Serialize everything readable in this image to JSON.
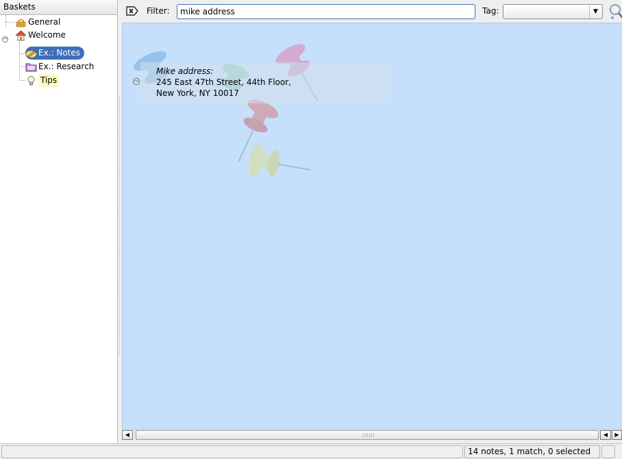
{
  "sidebar": {
    "header": "Baskets",
    "items": [
      {
        "label": "General",
        "icon": "basket-icon"
      },
      {
        "label": "Welcome",
        "icon": "home-icon"
      },
      {
        "label": "Ex.: Notes",
        "icon": "pencil-icon",
        "selected": true
      },
      {
        "label": "Ex.: Research",
        "icon": "folder-icon"
      },
      {
        "label": "Tips",
        "icon": "lightbulb-icon"
      }
    ]
  },
  "filter_bar": {
    "filter_label": "Filter:",
    "filter_value": "mike address",
    "tag_label": "Tag:",
    "tag_value": ""
  },
  "note": {
    "title": "Mike address:",
    "line1": "245 East 47th Street, 44th Floor,",
    "line2": "New York, NY 10017"
  },
  "status": {
    "text": "14 notes, 1 match, 0 selected"
  },
  "colors": {
    "basket_background": "#c6e0fb",
    "selection": "#3d6fb8",
    "tip_highlight": "#fdfbc4"
  }
}
